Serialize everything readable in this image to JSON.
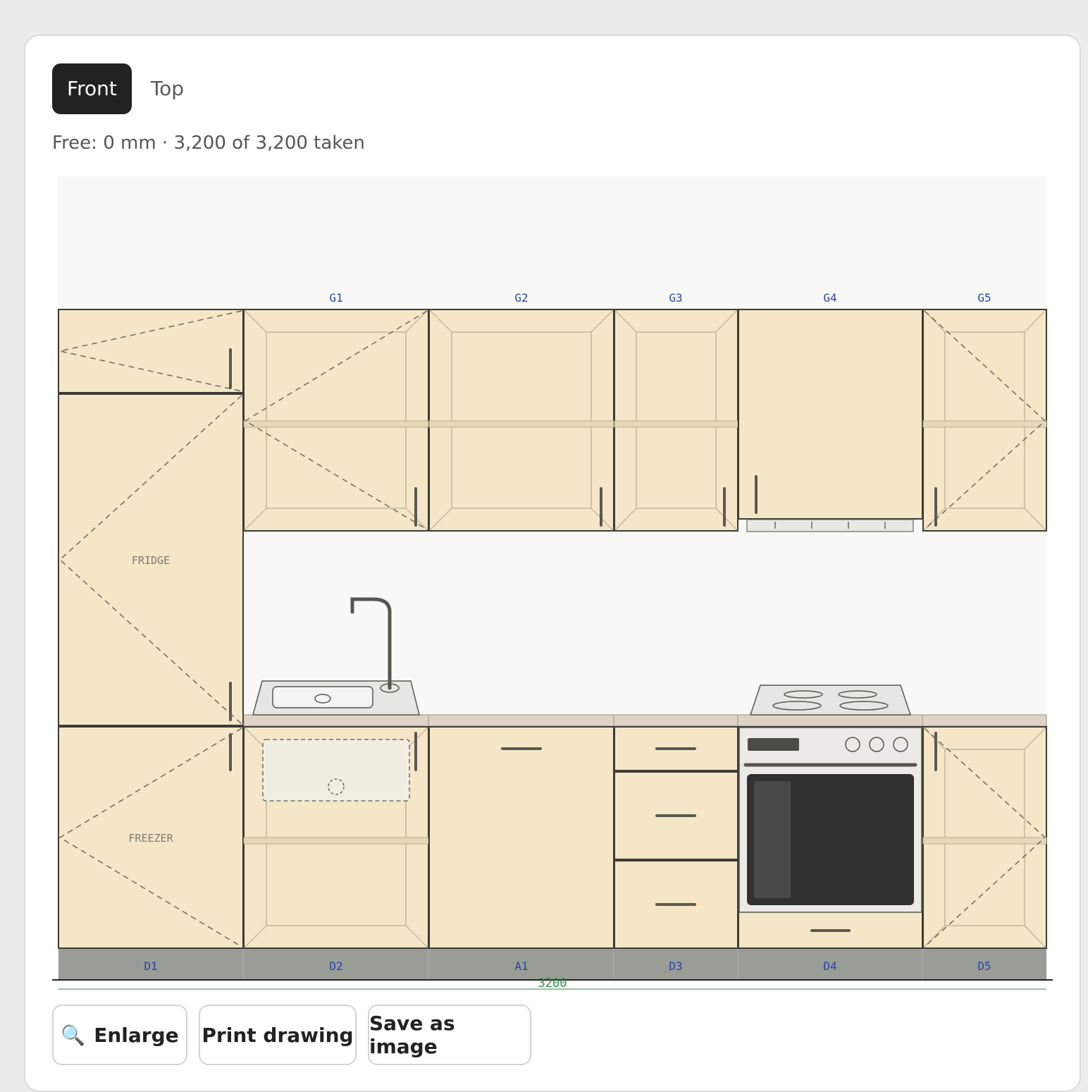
{
  "view_tabs": [
    {
      "label": "Front",
      "active": true
    },
    {
      "label": "Top",
      "active": false
    }
  ],
  "status_text": "Free: 0 mm · 3,200 of 3,200 taken",
  "drawing": {
    "wall_labels": [
      "G1",
      "G2",
      "G3",
      "G4",
      "G5"
    ],
    "base_labels": [
      "D1",
      "D2",
      "A1",
      "D3",
      "D4",
      "D5"
    ],
    "fridge_label": "FRIDGE",
    "freezer_label": "FREEZER",
    "total_width_label": "3200"
  },
  "colors": {
    "cabinet_fill": "#f5e6c7",
    "outline": "#3a3c35",
    "label_blue": "#2747a8",
    "dimension_green": "#2b8a3e",
    "plinth": "#9a9c96",
    "countertop": "#ded3c4"
  },
  "buttons": {
    "enlarge": {
      "label": "Enlarge",
      "icon": "magnifier-icon"
    },
    "print": {
      "label": "Print drawing"
    },
    "save": {
      "label": "Save as image"
    }
  }
}
